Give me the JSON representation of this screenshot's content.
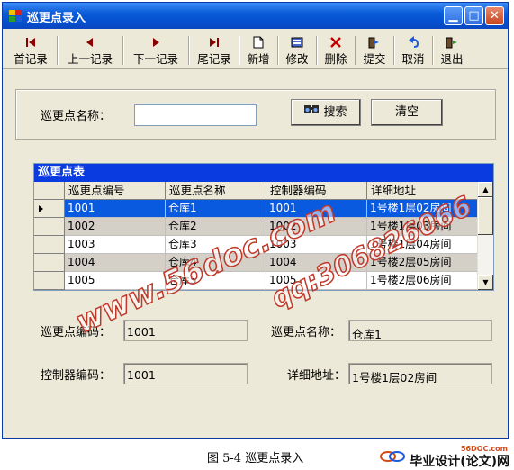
{
  "window": {
    "title": "巡更点录入"
  },
  "toolbar": {
    "buttons": [
      {
        "label": "首记录",
        "icon": "first-record-icon"
      },
      {
        "label": "上一记录",
        "icon": "prev-record-icon"
      },
      {
        "label": "下一记录",
        "icon": "next-record-icon"
      },
      {
        "label": "尾记录",
        "icon": "last-record-icon"
      },
      {
        "label": "新增",
        "icon": "new-document-icon"
      },
      {
        "label": "修改",
        "icon": "edit-icon"
      },
      {
        "label": "删除",
        "icon": "delete-icon"
      },
      {
        "label": "提交",
        "icon": "submit-icon"
      },
      {
        "label": "取消",
        "icon": "undo-icon"
      },
      {
        "label": "退出",
        "icon": "exit-icon"
      }
    ]
  },
  "search": {
    "label": "巡更点名称：",
    "value": "",
    "search_button": "搜索",
    "clear_button": "清空"
  },
  "grid": {
    "caption": "巡更点表",
    "columns": [
      "巡更点编号",
      "巡更点名称",
      "控制器编码",
      "详细地址"
    ],
    "rows": [
      [
        "1001",
        "仓库1",
        "1001",
        "1号楼1层02房间"
      ],
      [
        "1002",
        "仓库2",
        "1002",
        "1号楼1层03房间"
      ],
      [
        "1003",
        "仓库3",
        "1003",
        "1号楼1层04房间"
      ],
      [
        "1004",
        "仓库4",
        "1004",
        "1号楼2层05房间"
      ],
      [
        "1005",
        "仓库5",
        "1005",
        "1号楼2层06房间"
      ]
    ]
  },
  "detail": {
    "point_code_label": "巡更点编码：",
    "point_code": "1001",
    "point_name_label": "巡更点名称：",
    "point_name": "仓库1",
    "controller_label": "控制器编码：",
    "controller": "1001",
    "address_label": "详细地址：",
    "address": "1号楼1层02房间"
  },
  "watermarks": [
    "www.56doc.com",
    "qq:306826066"
  ],
  "figure_caption": "图 5-4 巡更点录入",
  "logo": {
    "url": "56DOC.com",
    "text": "毕业设计(论文)网"
  },
  "colors": {
    "titlebar": "#0a5bd8",
    "selection": "#0a5ae0",
    "watermark": "#c0392b"
  }
}
